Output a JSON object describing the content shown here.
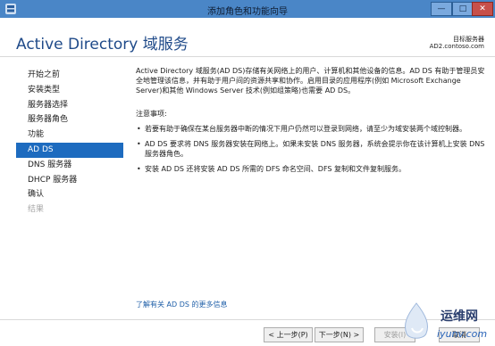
{
  "window": {
    "title": "添加角色和功能向导",
    "minimize_glyph": "—",
    "maximize_glyph": "□",
    "close_glyph": "✕"
  },
  "header": {
    "page_title": "Active Directory 域服务",
    "destination_label": "目标服务器",
    "destination_server": "AD2.contoso.com"
  },
  "nav": {
    "items": [
      {
        "label": "开始之前",
        "state": "normal"
      },
      {
        "label": "安装类型",
        "state": "normal"
      },
      {
        "label": "服务器选择",
        "state": "normal"
      },
      {
        "label": "服务器角色",
        "state": "normal"
      },
      {
        "label": "功能",
        "state": "normal"
      },
      {
        "label": "AD DS",
        "state": "active"
      },
      {
        "label": "DNS 服务器",
        "state": "normal"
      },
      {
        "label": "DHCP 服务器",
        "state": "normal"
      },
      {
        "label": "确认",
        "state": "normal"
      },
      {
        "label": "结果",
        "state": "disabled"
      }
    ]
  },
  "content": {
    "intro": "Active Directory 域服务(AD DS)存储有关网络上的用户、计算机和其他设备的信息。AD DS 有助于管理员安全地管理该信息，并有助于用户间的资源共享和协作。启用目录的应用程序(例如 Microsoft Exchange Server)和其他 Windows Server 技术(例如组策略)也需要 AD DS。",
    "notes_heading": "注意事项:",
    "bullet_glyph": "•",
    "bullets": [
      "若要有助于确保在某台服务器中断的情况下用户仍然可以登录到网络，请至少为域安装两个域控制器。",
      "AD DS 要求将 DNS 服务器安装在网络上。如果未安装 DNS 服务器，系统会提示你在该计算机上安装 DNS 服务器角色。",
      "安装 AD DS 还将安装 AD DS 所需的 DFS 命名空间、DFS 复制和文件复制服务。"
    ],
    "more_link": "了解有关 AD DS 的更多信息"
  },
  "footer": {
    "prev_label": "< 上一步(P)",
    "next_label": "下一步(N) >",
    "install_label": "安装(I)",
    "cancel_label": "取消"
  },
  "watermark": {
    "brand": "运维网",
    "url": "iyunv.com"
  },
  "colors": {
    "titlebar": "#4a86c7",
    "accent": "#1d6bbf",
    "title_text": "#1f4a89",
    "link": "#1f5fa8"
  }
}
